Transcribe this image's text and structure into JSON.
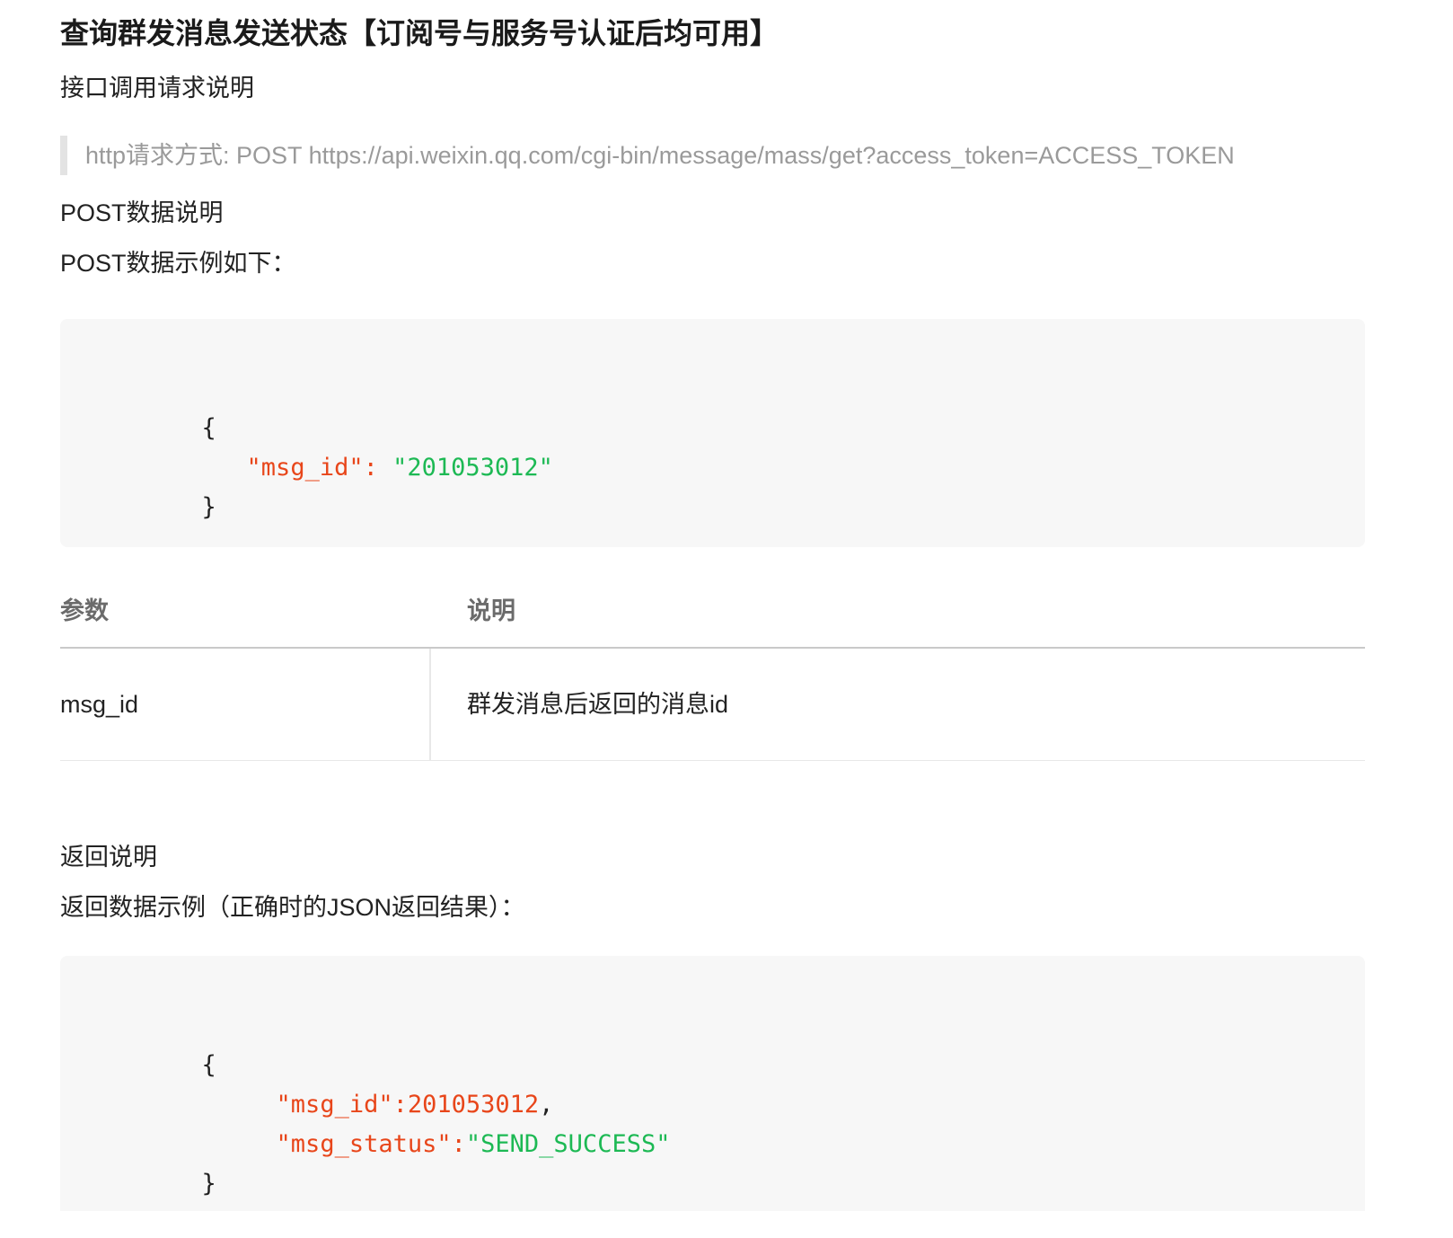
{
  "title": "查询群发消息发送状态【订阅号与服务号认证后均可用】",
  "sections": {
    "request_heading": "接口调用请求说明",
    "request_method": "http请求方式: POST https://api.weixin.qq.com/cgi-bin/message/mass/get?access_token=ACCESS_TOKEN",
    "post_heading": "POST数据说明",
    "post_example_heading": "POST数据示例如下："
  },
  "post_example": {
    "open_brace": "{",
    "key": "\"msg_id\"",
    "colon": ": ",
    "value": "\"201053012\"",
    "close_brace": "}"
  },
  "params_table": {
    "headers": [
      "参数",
      "说明"
    ],
    "rows": [
      [
        "msg_id",
        "群发消息后返回的消息id"
      ]
    ]
  },
  "response": {
    "heading": "返回说明",
    "example_heading": "返回数据示例（正确时的JSON返回结果）："
  },
  "response_example": {
    "open_brace": "{",
    "line1_key": "\"msg_id\"",
    "line1_colon": ":",
    "line1_value": "201053012",
    "line1_comma": ",",
    "line2_key": "\"msg_status\"",
    "line2_colon": ":",
    "line2_value": "\"SEND_SUCCESS\"",
    "close_brace": "}"
  },
  "colors": {
    "code_key": "#e8461a",
    "code_string": "#1db954",
    "code_background": "#f7f7f7",
    "muted_text": "#9a9a9a"
  }
}
